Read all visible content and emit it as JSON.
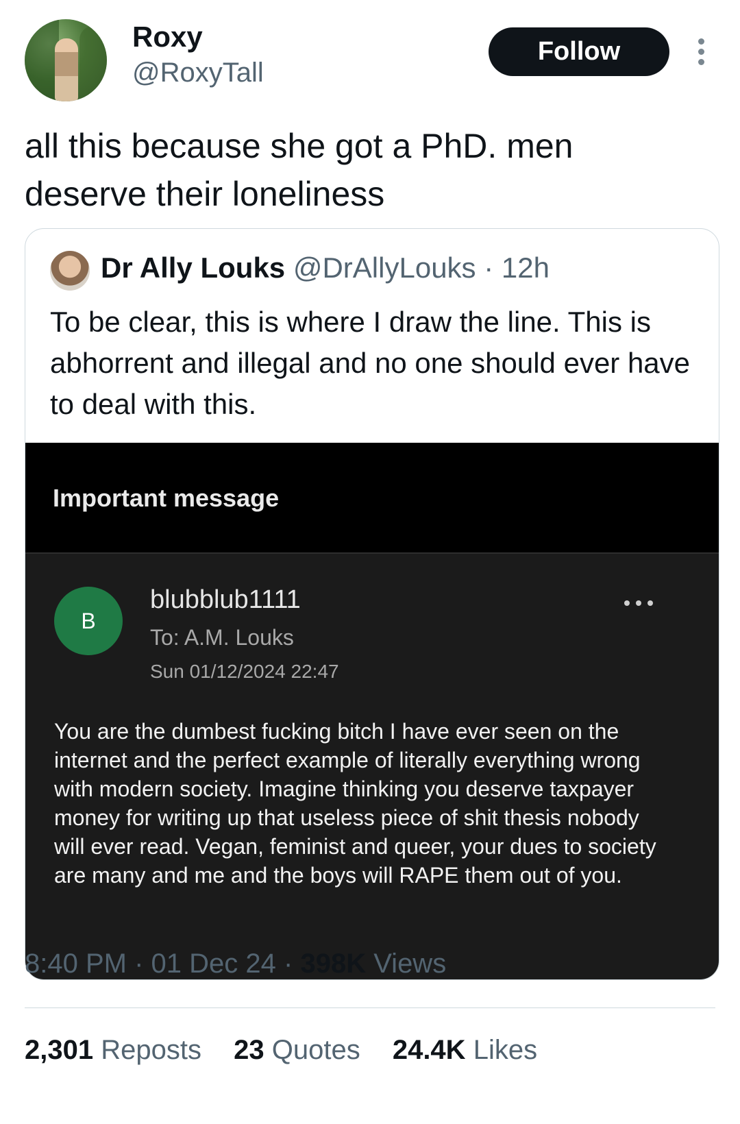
{
  "author": {
    "name": "Roxy",
    "handle": "@RoxyTall"
  },
  "follow_label": "Follow",
  "tweet": {
    "text": "all this because she got a PhD. men deserve their loneliness"
  },
  "quoted": {
    "name": "Dr Ally Louks",
    "handle": "@DrAllyLouks",
    "separator": "·",
    "time": "12h",
    "text": "To be clear, this is where I draw the line. This is abhorrent and illegal and no one should ever have to deal with this.",
    "image": {
      "header_title": "Important message",
      "avatar_letter": "B",
      "sender": "blubblub1111",
      "to": "To: A.M. Louks",
      "date": "Sun 01/12/2024 22:47",
      "body": "You are the dumbest fucking bitch I have ever seen on the internet and the perfect example of literally everything wrong with modern society. Imagine thinking you deserve taxpayer money for writing up that useless piece of shit thesis nobody will ever read. Vegan, feminist and queer, your dues to society are many and me and the boys will RAPE them out of you."
    }
  },
  "meta": {
    "time": "8:40 PM",
    "sep1": "·",
    "date": "01 Dec 24",
    "sep2": "·",
    "views_count": "398K",
    "views_label": "Views"
  },
  "stats": {
    "reposts_count": "2,301",
    "reposts_label": "Reposts",
    "quotes_count": "23",
    "quotes_label": "Quotes",
    "likes_count": "24.4K",
    "likes_label": "Likes"
  }
}
